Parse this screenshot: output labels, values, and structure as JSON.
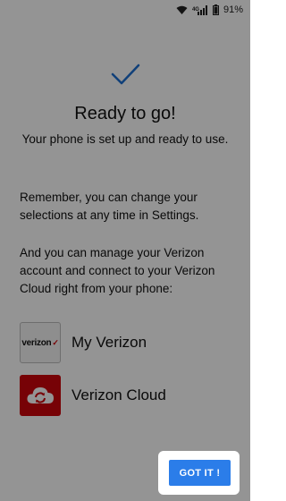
{
  "status_bar": {
    "network_label": "4G",
    "battery_percent": "91%",
    "icons": [
      "wifi-icon",
      "lte-signal-icon",
      "battery-icon"
    ]
  },
  "main": {
    "check_icon": "checkmark-icon",
    "title": "Ready to go!",
    "subtitle": "Your phone is set up and ready to use.",
    "paragraph_1": "Remember, you can change your selections at any time in Settings.",
    "paragraph_2": "And you can manage your Verizon account and connect to your Verizon Cloud right from your phone:"
  },
  "apps": [
    {
      "label": "My Verizon",
      "icon_text": "verizon",
      "icon_mark": "✓",
      "icon": "my-verizon-icon"
    },
    {
      "label": "Verizon Cloud",
      "icon": "verizon-cloud-icon"
    }
  ],
  "actions": {
    "got_it_label": "GOT IT !"
  },
  "colors": {
    "accent": "#2b7de9",
    "verizon_red": "#cd040b",
    "overlay": "rgba(0,0,0,0.42)"
  }
}
